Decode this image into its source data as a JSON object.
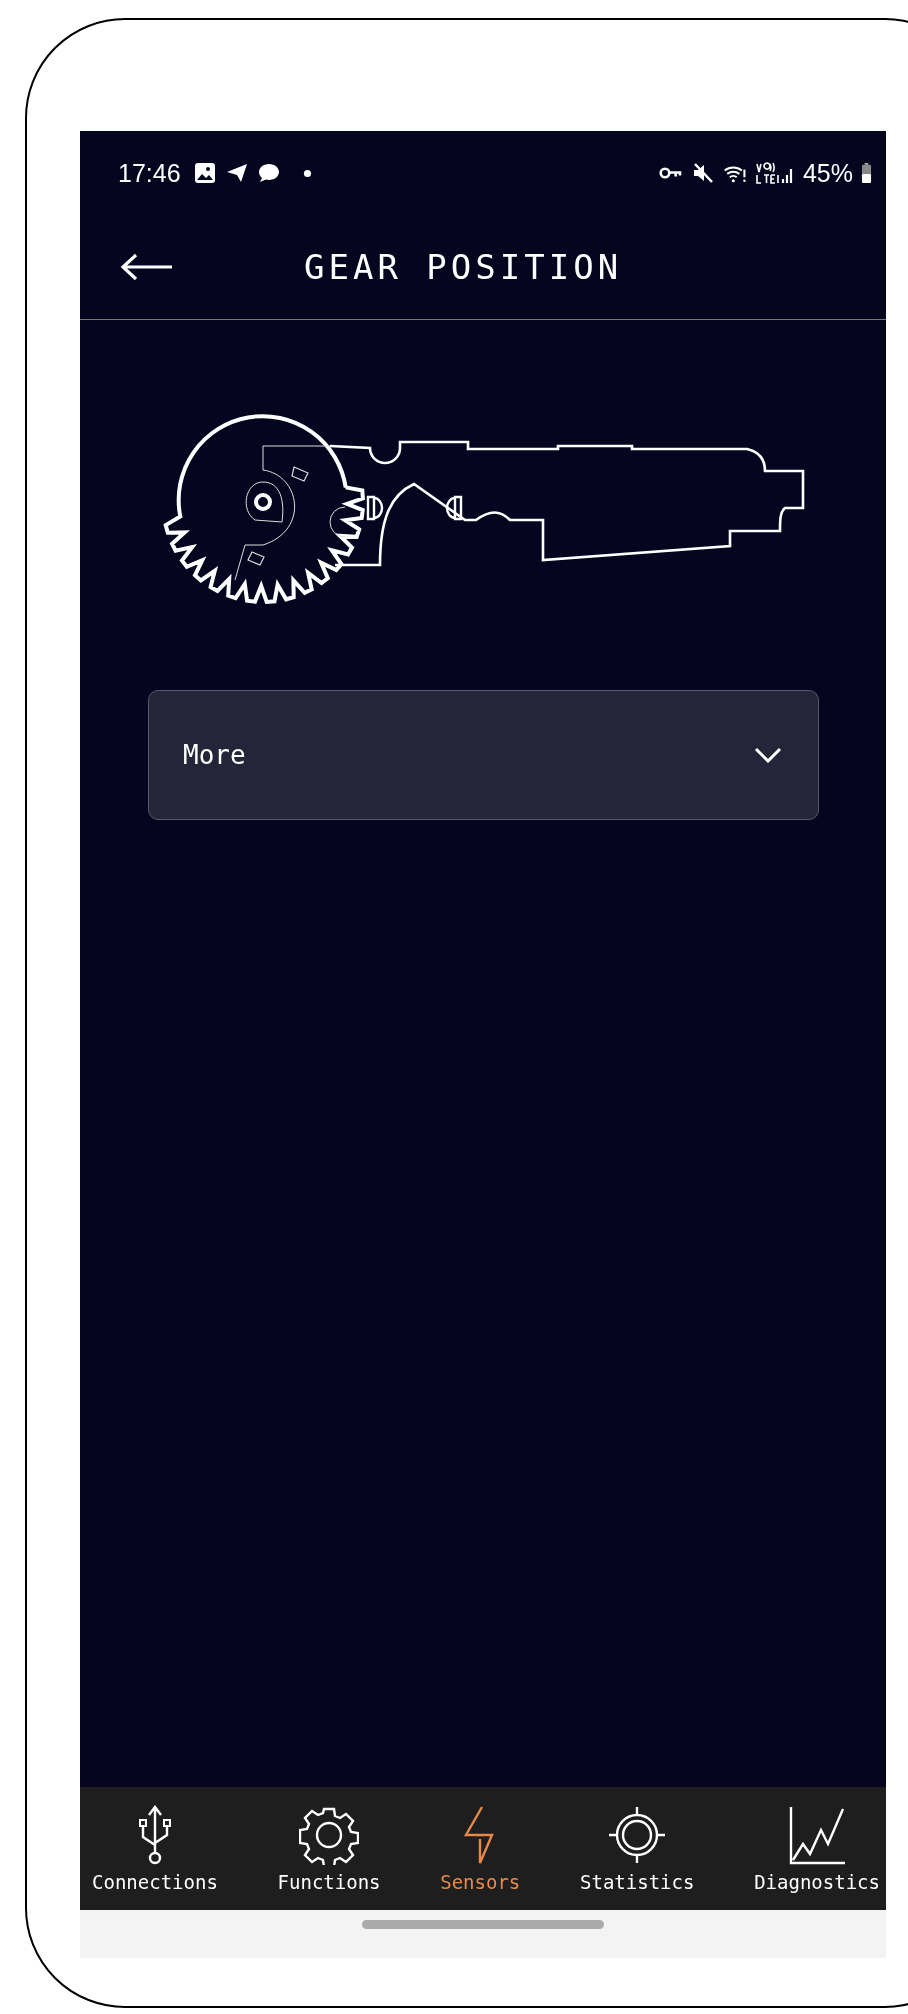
{
  "status_bar": {
    "time": "17:46",
    "battery": "45%"
  },
  "header": {
    "title": "GEAR POSITION"
  },
  "dropdown": {
    "label": "More",
    "expanded": false
  },
  "bottom_nav": [
    {
      "label": "Connections",
      "kind": "usb",
      "selected": false
    },
    {
      "label": "Functions",
      "kind": "gear",
      "selected": false
    },
    {
      "label": "Sensors",
      "kind": "bolt",
      "selected": true
    },
    {
      "label": "Statistics",
      "kind": "target",
      "selected": false
    },
    {
      "label": "Diagnostics",
      "kind": "chart",
      "selected": false
    }
  ]
}
